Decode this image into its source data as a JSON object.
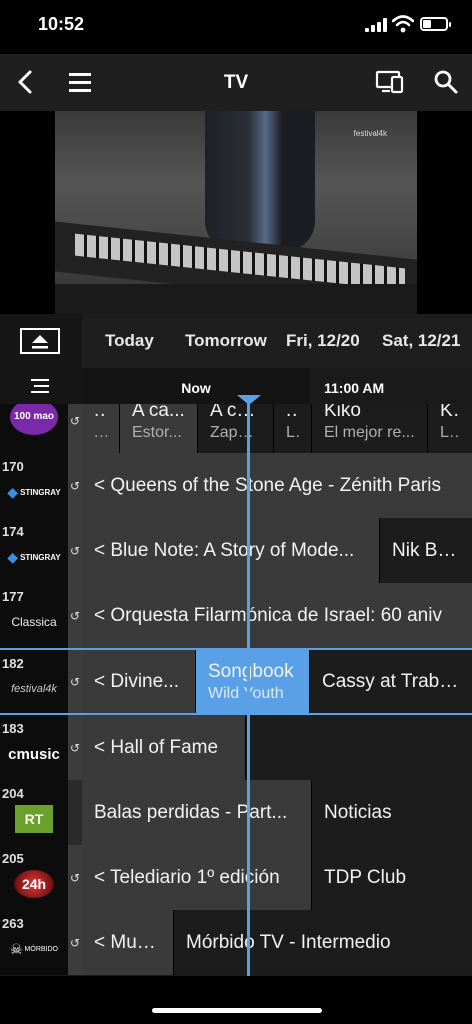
{
  "status": {
    "time": "10:52"
  },
  "nav": {
    "title": "TV"
  },
  "video": {
    "logo": "festival4k"
  },
  "dates": [
    "Today",
    "Tomorrow",
    "Fri, 12/20",
    "Sat, 12/21"
  ],
  "timebar": {
    "now": "Now",
    "time": "11:00 AM"
  },
  "channels": [
    {
      "num": "",
      "logo": "100 mao",
      "programs": [
        {
          "title": "...",
          "sub": "...",
          "type": "past"
        },
        {
          "title": "A ca...",
          "sub": "Estor...",
          "type": "past"
        },
        {
          "title": "A ca...",
          "sub": "Zapat...",
          "type": "future"
        },
        {
          "title": "...",
          "sub": "L...",
          "type": "future"
        },
        {
          "title": "Kiko",
          "sub": "El mejor re...",
          "type": "future"
        },
        {
          "title": "Kiko",
          "sub": "La a",
          "type": "future"
        }
      ]
    },
    {
      "num": "170",
      "logo": "STINGRAY",
      "programs": [
        {
          "title": "< Queens of the Stone Age - Zénith Paris",
          "sub": "",
          "type": "past"
        }
      ]
    },
    {
      "num": "174",
      "logo": "STINGRAY",
      "programs": [
        {
          "title": "< Blue Note: A Story of Mode...",
          "sub": "",
          "type": "past"
        },
        {
          "title": "Nik Bärts",
          "sub": "",
          "type": "future"
        }
      ]
    },
    {
      "num": "177",
      "logo": "Classica",
      "programs": [
        {
          "title": "< Orquesta Filarmónica de Israel: 60 aniv",
          "sub": "",
          "type": "past"
        }
      ]
    },
    {
      "num": "182",
      "logo": "festival4k",
      "programs": [
        {
          "title": "< Divine...",
          "sub": "",
          "type": "past"
        },
        {
          "title": "Songbook",
          "sub": "Wild Youth",
          "type": "hl"
        },
        {
          "title": "Cassy at Traben",
          "sub": "",
          "type": "future"
        }
      ]
    },
    {
      "num": "183",
      "logo": "cmusic",
      "programs": [
        {
          "title": "< Hall of Fame",
          "sub": "",
          "type": "past"
        }
      ]
    },
    {
      "num": "204",
      "logo": "RT",
      "programs": [
        {
          "title": "Balas perdidas - Part...",
          "sub": "",
          "type": "past"
        },
        {
          "title": "Noticias",
          "sub": "",
          "type": "future"
        }
      ]
    },
    {
      "num": "205",
      "logo": "24h",
      "programs": [
        {
          "title": "< Telediario 1º edición",
          "sub": "",
          "type": "past"
        },
        {
          "title": "TDP Club",
          "sub": "",
          "type": "future"
        }
      ]
    },
    {
      "num": "263",
      "logo": "MÓRBIDO",
      "programs": [
        {
          "title": "< Mun...",
          "sub": "",
          "type": "past"
        },
        {
          "title": "Mórbido TV - Intermedio",
          "sub": "",
          "type": "future"
        }
      ]
    }
  ],
  "colors": {
    "accent": "#5aa0e6",
    "background": "#1a1a1a"
  }
}
